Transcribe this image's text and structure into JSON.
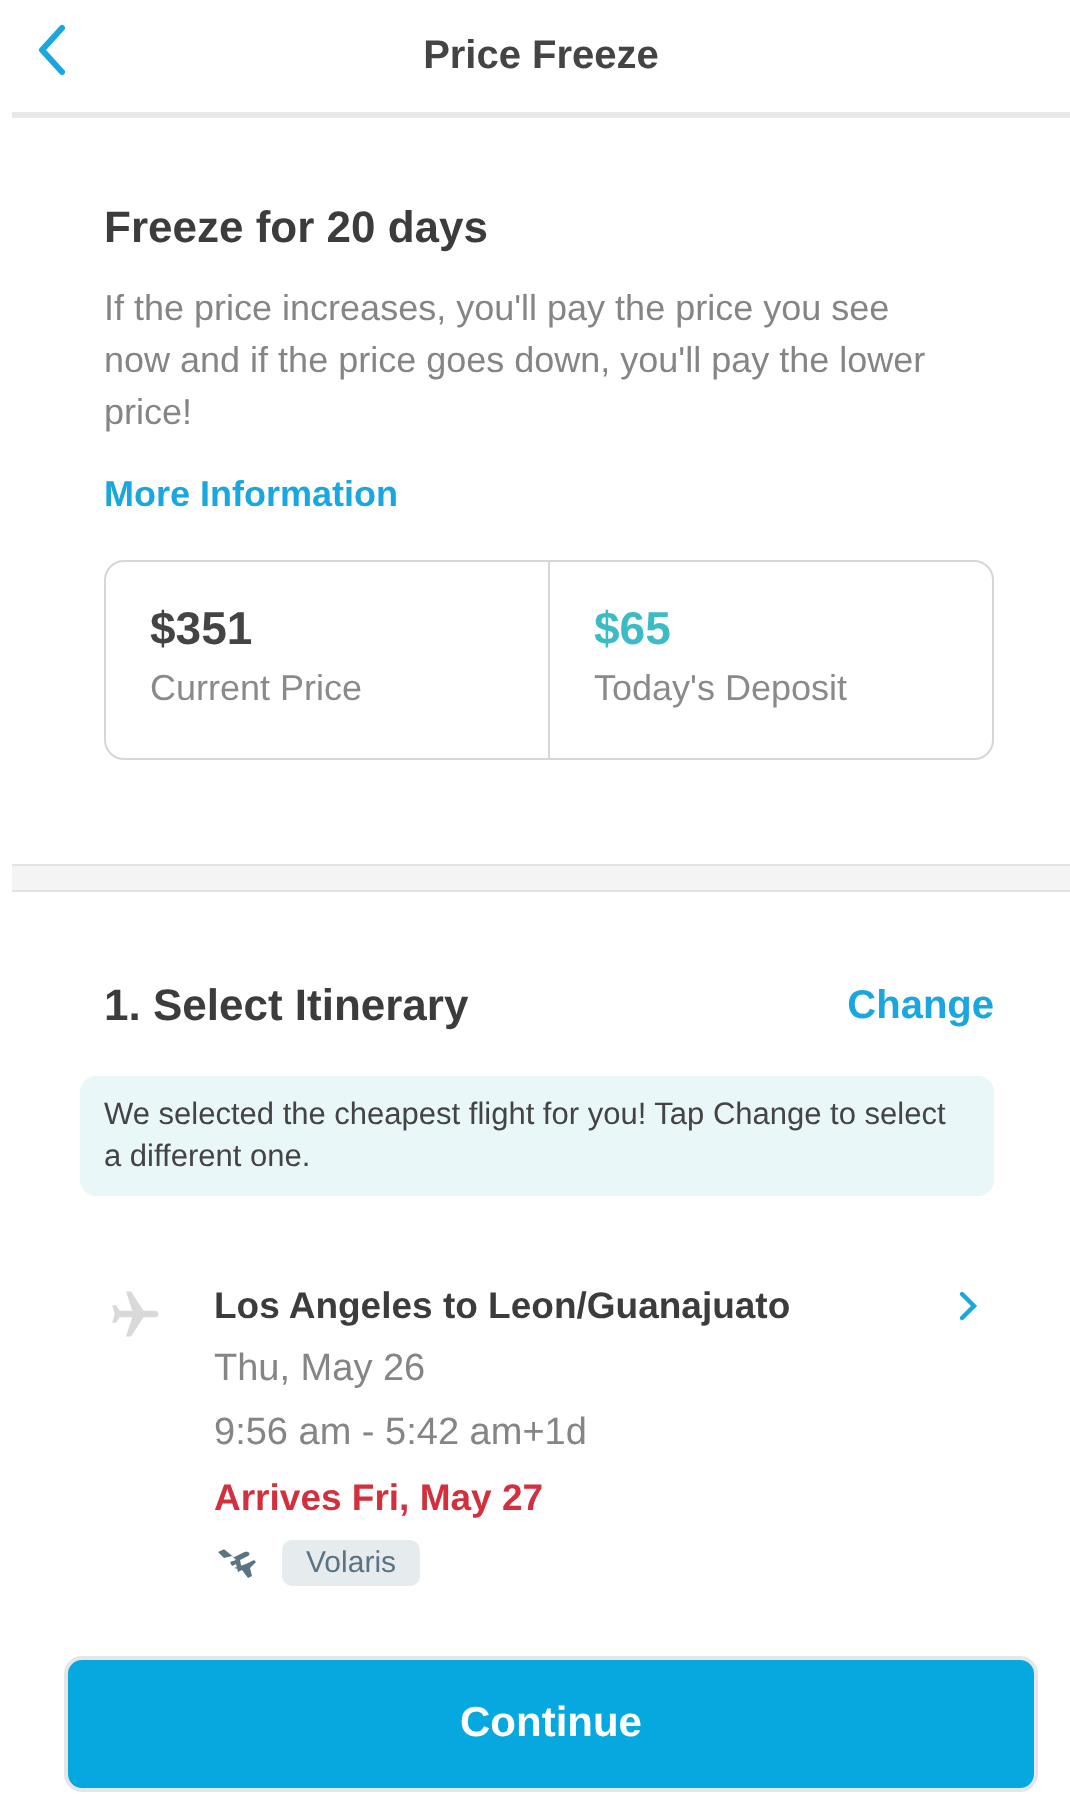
{
  "header": {
    "title": "Price Freeze"
  },
  "freeze": {
    "title": "Freeze for 20 days",
    "description": "If the price increases, you'll pay the price you see now and if the price goes down, you'll pay the lower price!",
    "link": "More Information",
    "prices": [
      {
        "kind": "current",
        "amount": "$351",
        "label": "Current Price"
      },
      {
        "kind": "deposit",
        "amount": "$65",
        "label": "Today's Deposit"
      }
    ]
  },
  "itinerary": {
    "title": "1. Select Itinerary",
    "action": "Change",
    "notice": "We selected the cheapest flight for you! Tap Change to select a different one.",
    "flights": [
      {
        "route": "Los Angeles to Leon/Guanajuato",
        "date": "Thu, May 26",
        "times": "9:56 am - 5:42 am+1d",
        "arrival": "Arrives Fri, May 27",
        "airline": "Volaris"
      }
    ]
  },
  "button": "Continue"
}
